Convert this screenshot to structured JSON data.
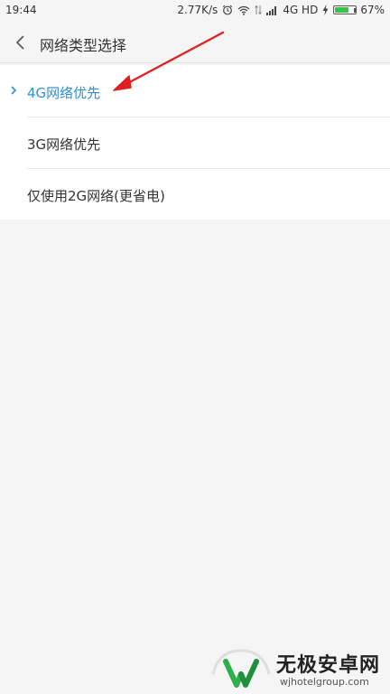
{
  "status_bar": {
    "time": "19:44",
    "speed": "2.77K/s",
    "network": "4G HD",
    "battery_percent": "67%",
    "battery_level": 0.67,
    "icons": [
      "alarm-icon",
      "wifi-icon",
      "data-arrows-icon",
      "signal-icon",
      "charging-icon",
      "battery-icon"
    ]
  },
  "header": {
    "title": "网络类型选择",
    "back_icon": "chevron-left-icon"
  },
  "options": [
    {
      "label": "4G网络优先",
      "selected": true
    },
    {
      "label": "3G网络优先",
      "selected": false
    },
    {
      "label": "仅使用2G网络(更省电)",
      "selected": false
    }
  ],
  "colors": {
    "selected": "#2d8fd0",
    "annotation_arrow": "#e02020",
    "background": "#f5f5f5"
  },
  "watermark": {
    "brand": "无极安卓网",
    "url": "wjhotelgroup.com"
  }
}
